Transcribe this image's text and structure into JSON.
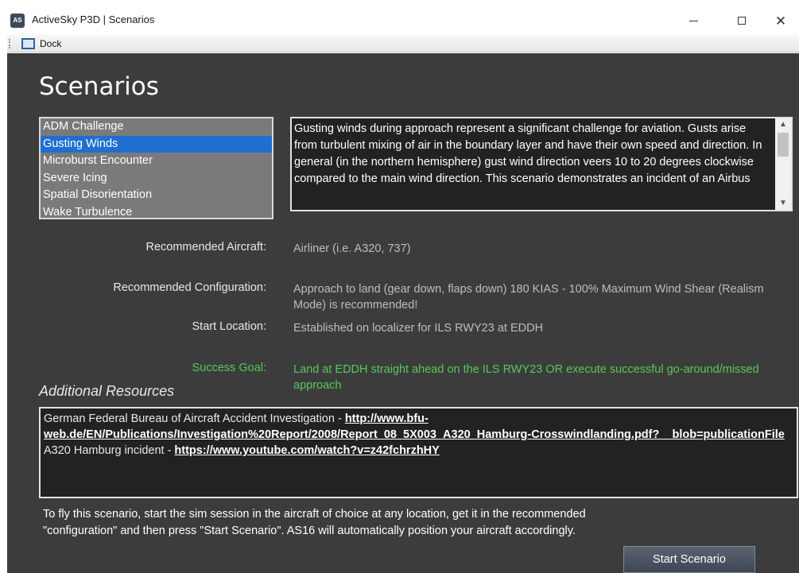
{
  "window": {
    "icon_text": "AS",
    "title": "ActiveSky P3D | Scenarios",
    "minimize_glyph": "—",
    "maximize_glyph": "☐",
    "close_glyph": "✕"
  },
  "toolbar": {
    "dock_label": "Dock"
  },
  "page": {
    "heading": "Scenarios"
  },
  "scenarios": {
    "items": [
      {
        "label": "ADM Challenge",
        "selected": false
      },
      {
        "label": "Gusting Winds",
        "selected": true
      },
      {
        "label": "Microburst Encounter",
        "selected": false
      },
      {
        "label": "Severe Icing",
        "selected": false
      },
      {
        "label": "Spatial Disorientation",
        "selected": false
      },
      {
        "label": "Wake Turbulence",
        "selected": false
      }
    ]
  },
  "description": {
    "text": "Gusting winds during approach represent a significant challenge for aviation. Gusts arise from turbulent mixing of air in the boundary layer and have their own speed and direction. In general (in the northern hemisphere) gust wind direction veers 10 to 20 degrees clockwise compared to the main wind direction. This scenario demonstrates an incident of an Airbus"
  },
  "details": {
    "aircraft_label": "Recommended Aircraft:",
    "aircraft_value": "Airliner (i.e. A320, 737)",
    "config_label": "Recommended Configuration:",
    "config_value": "Approach to land (gear down, flaps down) 180 KIAS - 100% Maximum Wind Shear (Realism Mode) is recommended!",
    "location_label": "Start Location:",
    "location_value": "Established on localizer for ILS RWY23 at EDDH",
    "goal_label": "Success Goal:",
    "goal_value": "Land at EDDH straight ahead on the ILS RWY23 OR execute successful go-around/missed approach"
  },
  "resources": {
    "heading": "Additional Resources",
    "line1_prefix": "German Federal Bureau of Aircraft Accident Investigation - ",
    "line1_link": "http://www.bfu-web.de/EN/Publications/Investigation%20Report/2008/Report_08_5X003_A320_Hamburg-Crosswindlanding.pdf?__blob=publicationFile",
    "line2_prefix": "A320 Hamburg incident - ",
    "line2_link": "https://www.youtube.com/watch?v=z42fchrzhHY"
  },
  "footer": {
    "instructions": "To fly this scenario, start the sim session in the aircraft of choice at any location, get it in the recommended \"configuration\" and then press \"Start Scenario\".  AS16 will automatically position your aircraft accordingly.",
    "start_button": "Start Scenario"
  },
  "colors": {
    "background": "#3c3c3c",
    "selection": "#1f6fcf",
    "success": "#57c85c"
  }
}
